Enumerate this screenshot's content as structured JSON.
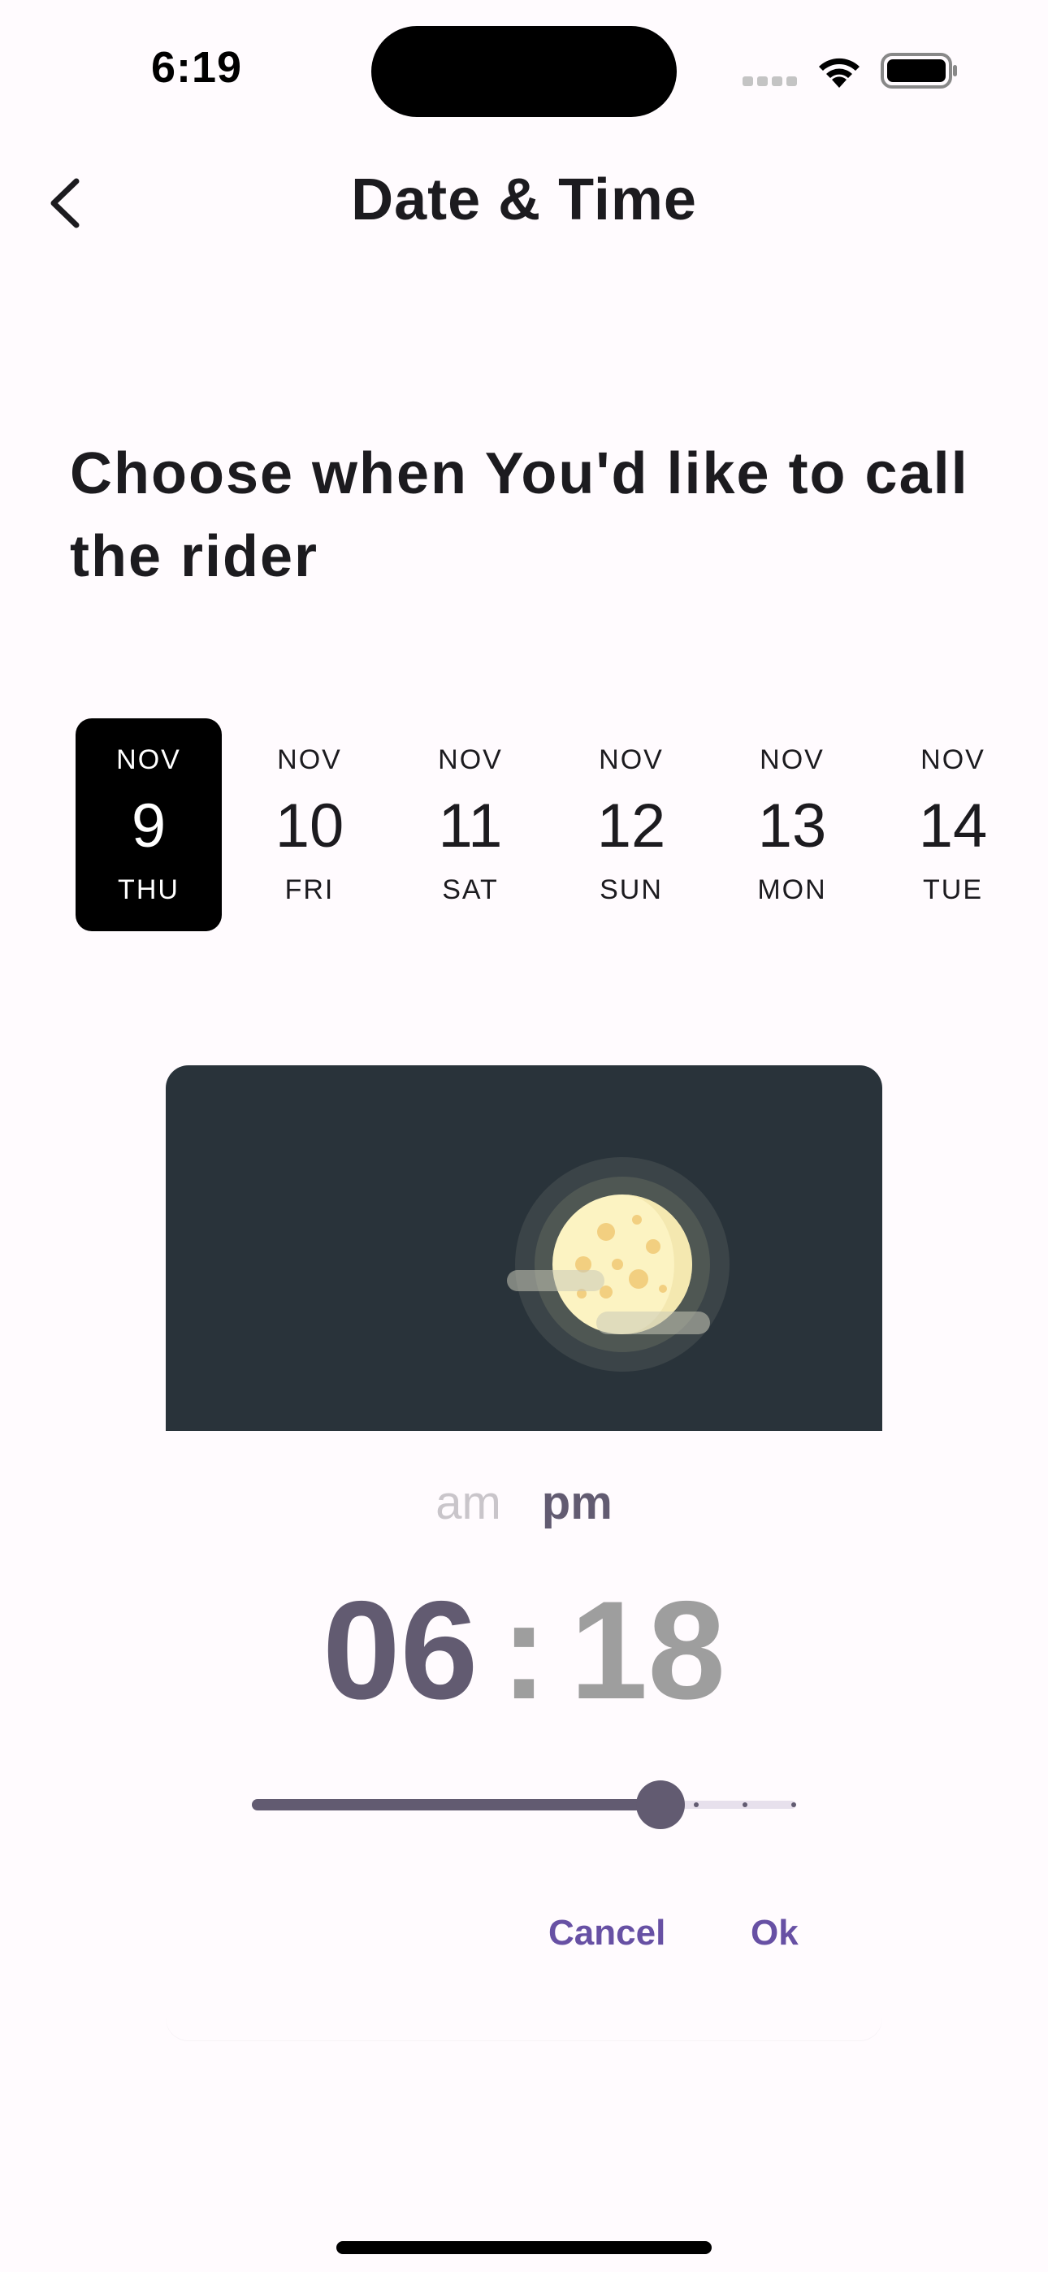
{
  "status_bar": {
    "time": "6:19"
  },
  "header": {
    "title": "Date & Time",
    "back_icon": "chevron-left-icon"
  },
  "heading": "Choose when You'd like to call the rider",
  "dates": [
    {
      "month": "NOV",
      "day": "9",
      "weekday": "THU",
      "selected": true
    },
    {
      "month": "NOV",
      "day": "10",
      "weekday": "FRI",
      "selected": false
    },
    {
      "month": "NOV",
      "day": "11",
      "weekday": "SAT",
      "selected": false
    },
    {
      "month": "NOV",
      "day": "12",
      "weekday": "SUN",
      "selected": false
    },
    {
      "month": "NOV",
      "day": "13",
      "weekday": "MON",
      "selected": false
    },
    {
      "month": "NOV",
      "day": "14",
      "weekday": "TUE",
      "selected": false
    }
  ],
  "time_picker": {
    "illustration": "moon-icon",
    "am_label": "am",
    "pm_label": "pm",
    "selected_period": "pm",
    "hours": "06",
    "separator": ":",
    "minutes": "18",
    "slider_value_fraction": 0.75,
    "cancel_label": "Cancel",
    "ok_label": "Ok"
  },
  "colors": {
    "accent": "#625b71",
    "button_text": "#6750a4",
    "selected_date_bg": "#000000",
    "sky": "#29333a"
  }
}
